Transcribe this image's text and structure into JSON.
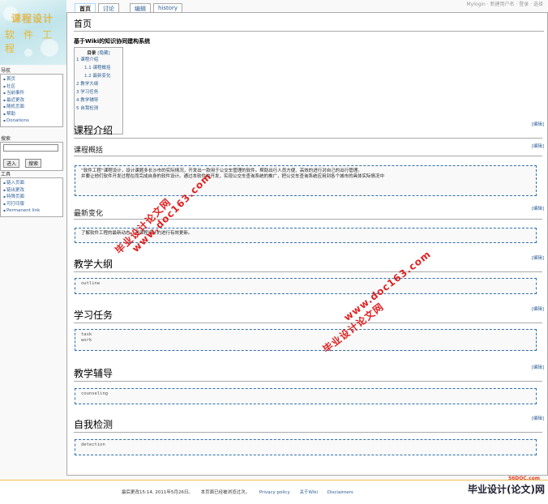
{
  "logo": {
    "line1": "课程设计",
    "line2": "软件工程"
  },
  "tabs": [
    "首页",
    "讨论",
    "编辑",
    "history"
  ],
  "userlinks": "Mylogin · 新建用户名 · 登录 · 选择",
  "sidebar": {
    "nav_title": "导航",
    "nav_items": [
      "首页",
      "社区",
      "当前事件",
      "最近更改",
      "随机页面",
      "帮助",
      "Donations"
    ],
    "search_title": "搜索",
    "search_go": "进入",
    "search_btn": "搜索",
    "tools_title": "工具",
    "tools_items": [
      "链入页面",
      "链出更改",
      "特殊页面",
      "可打印版",
      "Permanent link"
    ]
  },
  "page": {
    "title": "首页",
    "subtitle": "基于Wiki的知识协同建构系统",
    "toc": {
      "title": "目录",
      "hide": "[隐藏]",
      "items": [
        {
          "text": "1 课程介绍",
          "sub": false
        },
        {
          "text": "1.1 课程概括",
          "sub": true
        },
        {
          "text": "1.2 最新变化",
          "sub": true
        },
        {
          "text": "2 教学大纲",
          "sub": false
        },
        {
          "text": "3 学习任务",
          "sub": false
        },
        {
          "text": "4 教学辅导",
          "sub": false
        },
        {
          "text": "5 自我检测",
          "sub": false
        }
      ]
    },
    "edit_label": "[编辑]",
    "sections": {
      "intro": "课程介绍",
      "overview": "课程概括",
      "overview_text_1": "“软件工程”课程设计，设计课题多长沙市的实际情况，开发出一款用于公交车管理的软件。帮助出行人员方便、高效的进行对自己的出行管理。",
      "overview_text_2": "并要让他们软件开发过程在而完成自身的软件设计。通过本软件的开发，实现公交车查询系统的推广，把公交车查询系统应用到各个城市的具体实际情况中",
      "changes": "最新变化",
      "changes_text": "了解软件工程的最新动态，对课程设计的进行有效更新。",
      "outline": "教学大纲",
      "outline_text": "outline",
      "tasks": "学习任务",
      "tasks_text_1": "task",
      "tasks_text_2": "work",
      "guide": "教学辅导",
      "guide_text": "counseling",
      "test": "自我检测",
      "test_text": "detection"
    }
  },
  "footer": {
    "modified": "最后更改15:14, 2011年5月26日。",
    "views": "本页面已经被浏览过次。",
    "privacy": "Privacy policy",
    "about": "关于Wiki",
    "disclaimers": "Disclaimers",
    "brand": "毕业设计(论文)网",
    "brand_small": "56DOC.com"
  },
  "watermarks": [
    "毕业设计论文网",
    "www.doc163.com"
  ]
}
